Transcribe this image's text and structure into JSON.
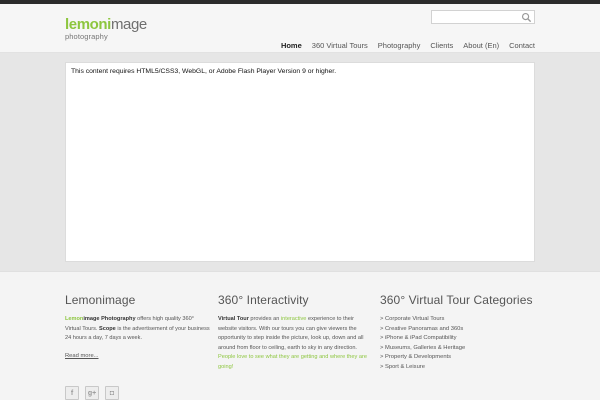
{
  "brand": {
    "logo_main_bold": "lemoni",
    "logo_main_rest": "mage",
    "logo_sub": "photography",
    "accent_color": "#8dc63f"
  },
  "search": {
    "placeholder": "",
    "value": "",
    "icon": "search-icon"
  },
  "nav": {
    "items": [
      {
        "label": "Home",
        "active": true
      },
      {
        "label": "360 Virtual Tours"
      },
      {
        "label": "Photography"
      },
      {
        "label": "Clients"
      },
      {
        "label": "About (En)"
      },
      {
        "label": "Contact"
      }
    ]
  },
  "main": {
    "notice": "This content requires HTML5/CSS3, WebGL, or Adobe Flash Player Version 9 or higher."
  },
  "footer": {
    "col1": {
      "title": "Lemonimage",
      "brand_bold_green": "Lemon",
      "brand_bold_rest": "image Photography",
      "text1": " offers high quality 360°",
      "text2": "Virtual Tours. ",
      "scope": "Scope",
      "text3": " is the advertisement of your business 24 hours a day, 7 days a week.",
      "read_more": "Read more..."
    },
    "col2": {
      "title": "360° Interactivity",
      "vt": "Virtual Tour",
      "text1": " provides an ",
      "interactive": "interactive",
      "text2": " experience to their website visitors. With our tours you can give viewers the opportunity to step inside the picture, look up, down and all around from floor to ceiling, earth to sky in any direction.",
      "green_text": "People love to see what they are getting and where they are going!"
    },
    "col3": {
      "title": "360° Virtual Tour Categories",
      "items": [
        "> Corporate Virtual Tours",
        "> Creative Panoramas and 360s",
        "> iPhone & iPad Compatibility",
        "> Museums, Galleries & Heritage",
        "> Property & Developments",
        "> Sport & Leisure"
      ]
    },
    "social": [
      {
        "icon": "facebook-icon",
        "glyph": "f"
      },
      {
        "icon": "google-plus-icon",
        "glyph": "g+"
      },
      {
        "icon": "instagram-icon",
        "glyph": "◘"
      }
    ]
  }
}
